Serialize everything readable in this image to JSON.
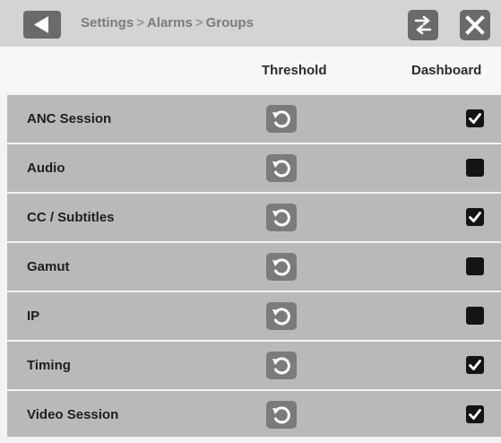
{
  "header": {
    "breadcrumb": [
      "Settings",
      "Alarms",
      "Groups"
    ],
    "breadcrumb_separator": ">",
    "back_icon": "back-arrow-icon",
    "swap_icon": "swap-arrows-icon",
    "close_icon": "close-x-icon"
  },
  "columns": {
    "threshold": "Threshold",
    "dashboard": "Dashboard"
  },
  "rows": [
    {
      "label": "ANC Session",
      "dashboard_checked": true
    },
    {
      "label": "Audio",
      "dashboard_checked": false
    },
    {
      "label": "CC / Subtitles",
      "dashboard_checked": true
    },
    {
      "label": "Gamut",
      "dashboard_checked": false
    },
    {
      "label": "IP",
      "dashboard_checked": false
    },
    {
      "label": "Timing",
      "dashboard_checked": true
    },
    {
      "label": "Video Session",
      "dashboard_checked": true
    }
  ],
  "colors": {
    "titlebar": "#d4d4d4",
    "row_background": "#b9b9b9",
    "button_gray": "#6a6a6a",
    "checkbox": "#141414"
  }
}
